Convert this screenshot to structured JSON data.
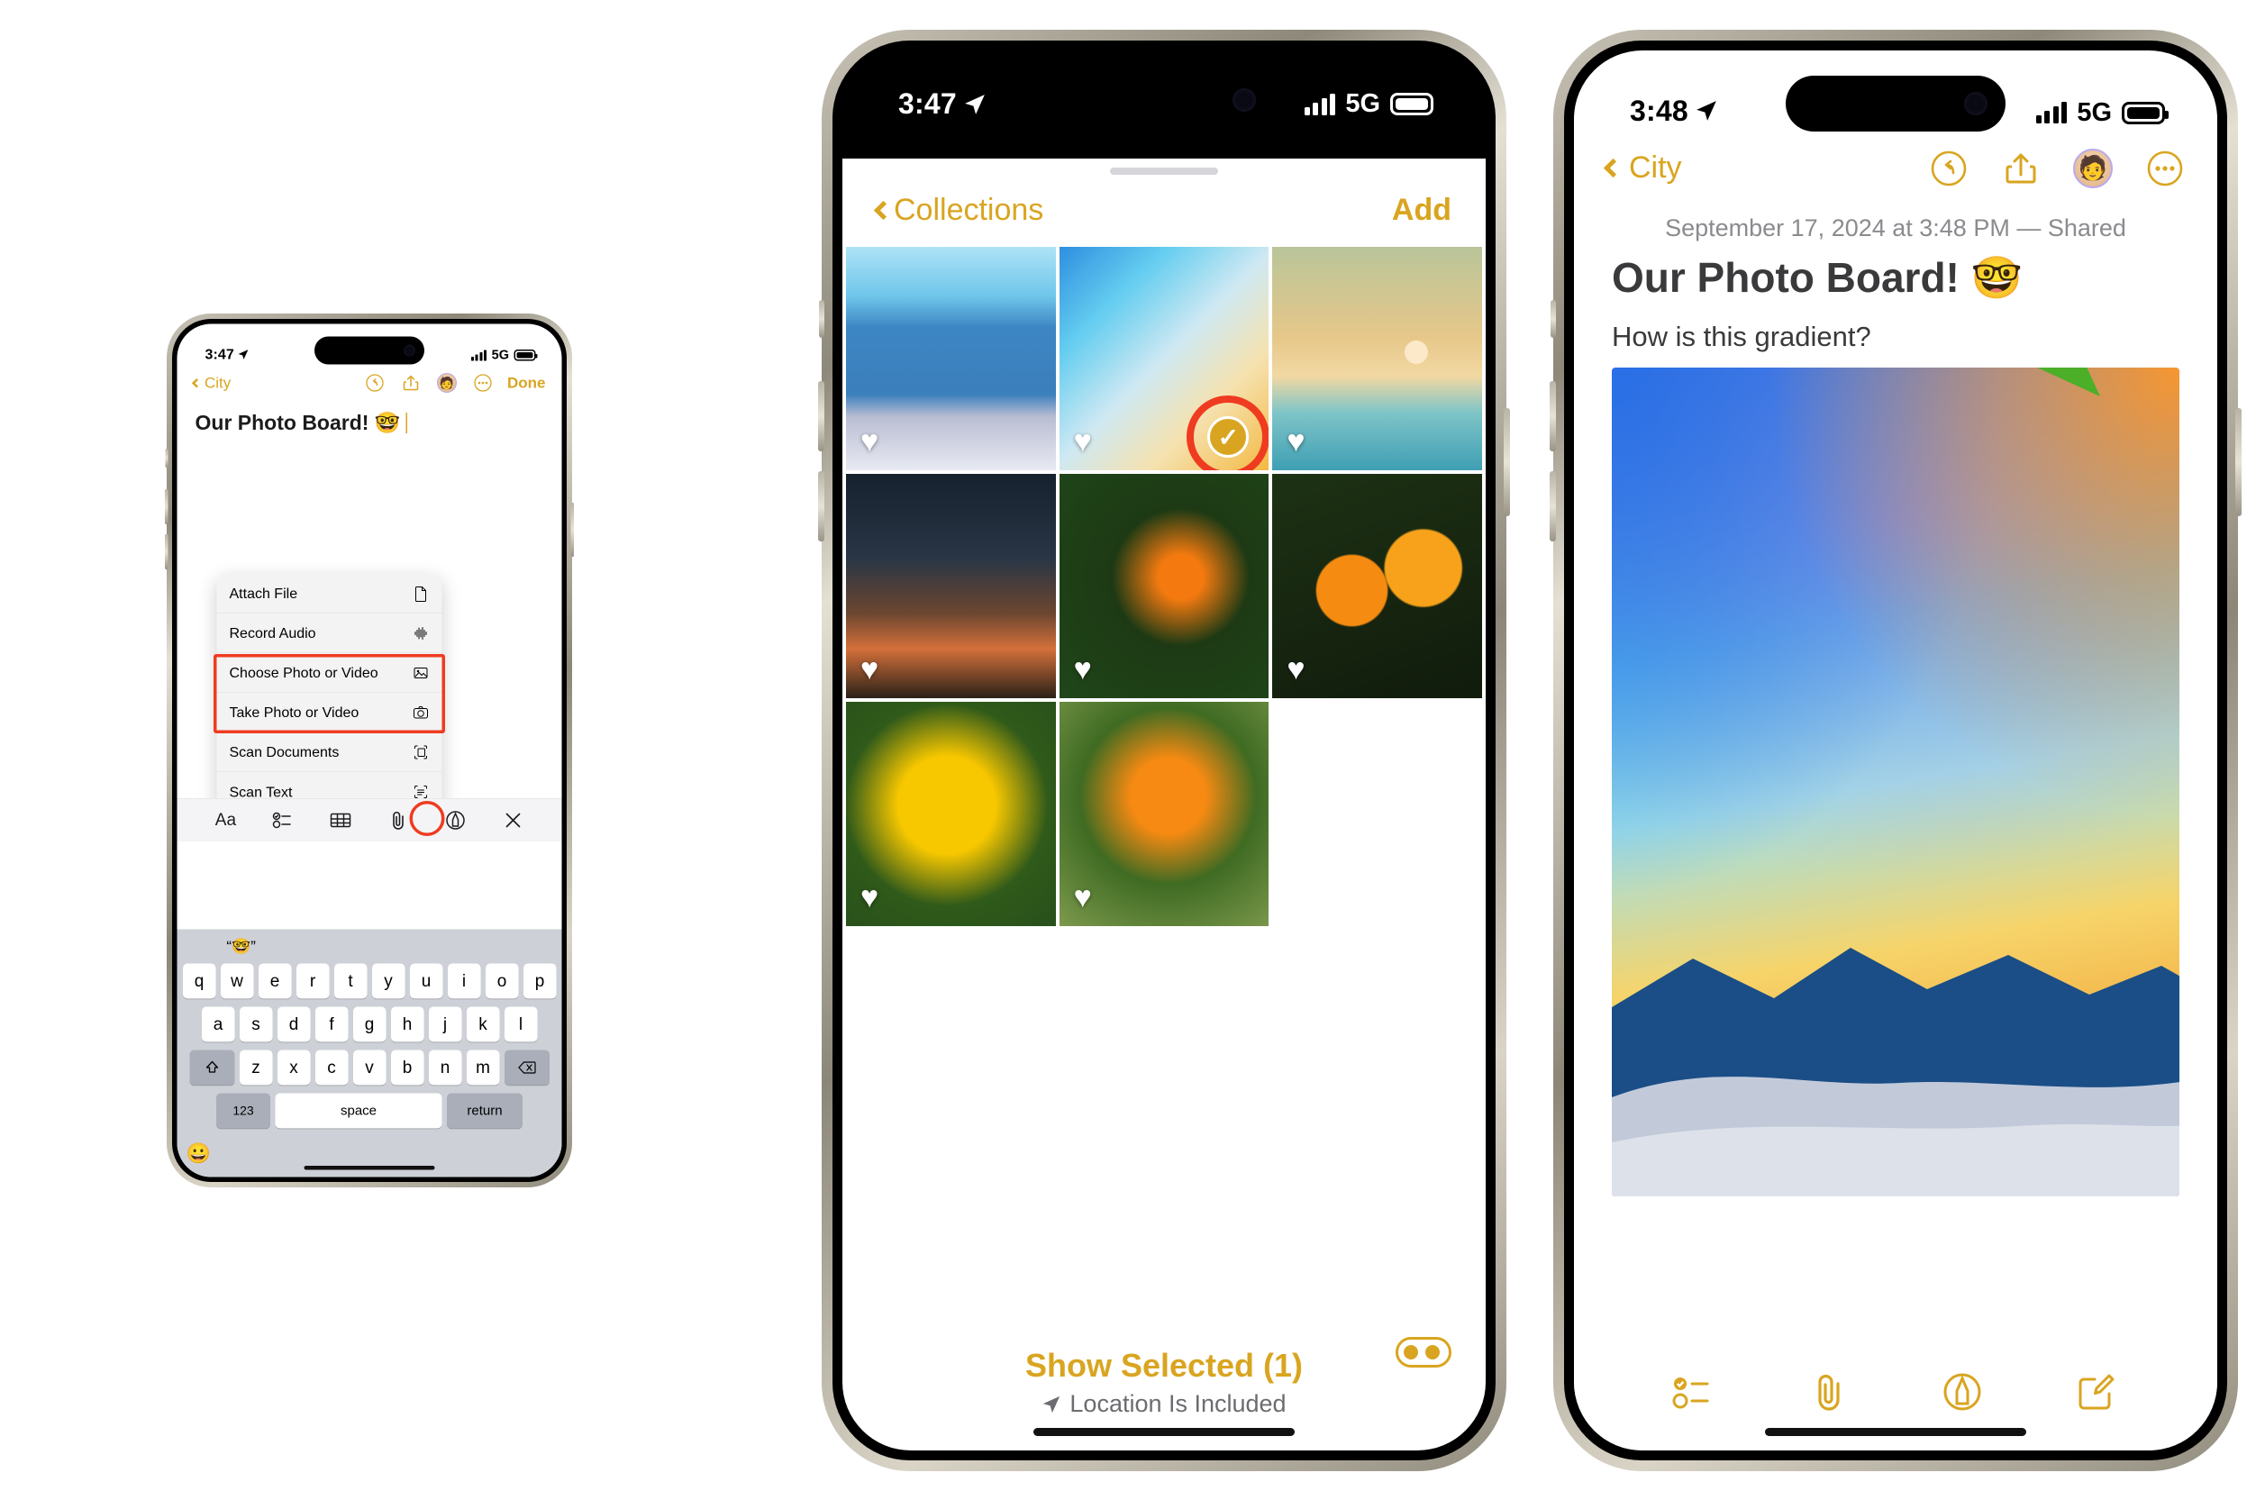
{
  "phone1": {
    "status": {
      "time": "3:47",
      "network": "5G",
      "location_icon": "location-arrow-icon"
    },
    "nav": {
      "back_label": "City",
      "done_label": "Done",
      "icons": [
        "undo-icon",
        "share-icon",
        "collaborator-avatar-icon",
        "more-icon"
      ]
    },
    "note": {
      "title": "Our Photo Board! 🤓"
    },
    "attach_menu": {
      "items": [
        {
          "label": "Attach File",
          "icon": "document-icon"
        },
        {
          "label": "Record Audio",
          "icon": "waveform-icon"
        },
        {
          "label": "Choose Photo or Video",
          "icon": "photo-library-icon"
        },
        {
          "label": "Take Photo or Video",
          "icon": "camera-icon"
        },
        {
          "label": "Scan Documents",
          "icon": "scan-document-icon"
        },
        {
          "label": "Scan Text",
          "icon": "scan-text-icon"
        }
      ],
      "highlighted_items": [
        "Choose Photo or Video",
        "Take Photo or Video"
      ]
    },
    "format_toolbar": {
      "items": [
        "Aa",
        "checklist-icon",
        "table-icon",
        "paperclip-icon",
        "markup-icon",
        "close-icon"
      ],
      "highlighted": "paperclip-icon"
    },
    "keyboard": {
      "prediction": "“🤓”",
      "row1": [
        "q",
        "w",
        "e",
        "r",
        "t",
        "y",
        "u",
        "i",
        "o",
        "p"
      ],
      "row2": [
        "a",
        "s",
        "d",
        "f",
        "g",
        "h",
        "j",
        "k",
        "l"
      ],
      "row3": [
        "z",
        "x",
        "c",
        "v",
        "b",
        "n",
        "m"
      ],
      "shift_icon": "shift-icon",
      "delete_icon": "delete-icon",
      "numbers_label": "123",
      "space_label": "space",
      "return_label": "return",
      "emoji_label": "😀"
    }
  },
  "phone2": {
    "status": {
      "time": "3:47",
      "network": "5G"
    },
    "nav": {
      "back_label": "Collections",
      "add_label": "Add",
      "add_highlighted": true
    },
    "grid": [
      {
        "name": "blue-mountain-gradient",
        "favorite": true,
        "selected": false
      },
      {
        "name": "cyan-orange-gradient",
        "favorite": true,
        "selected": true
      },
      {
        "name": "teal-sunrise-mountains",
        "favorite": true,
        "selected": false
      },
      {
        "name": "dusk-horizon",
        "favorite": true,
        "selected": false
      },
      {
        "name": "marigold-foliage",
        "favorite": true,
        "selected": false
      },
      {
        "name": "two-marigolds",
        "favorite": true,
        "selected": false
      },
      {
        "name": "large-yellow-marigold",
        "favorite": true,
        "selected": false
      },
      {
        "name": "single-orange-marigold",
        "favorite": true,
        "selected": false
      }
    ],
    "footer": {
      "show_selected": "Show Selected (1)",
      "location": "Location Is Included",
      "toggle_icon": "filters-toggle-icon"
    }
  },
  "phone3": {
    "status": {
      "time": "3:48",
      "network": "5G"
    },
    "nav": {
      "back_label": "City",
      "icons": [
        "undo-icon",
        "share-icon",
        "collaborator-avatar-icon",
        "more-icon"
      ]
    },
    "meta": "September 17, 2024 at 3:48 PM — Shared",
    "note": {
      "title": "Our Photo Board! 🤓",
      "body": "How is this gradient?"
    },
    "attachment": {
      "name": "gradient-mountain-photo",
      "annotation": "green-arrow-pointer"
    },
    "toolbar": [
      "checklist-icon",
      "paperclip-icon",
      "markup-icon",
      "compose-icon"
    ]
  },
  "colors": {
    "accent": "#d9a520",
    "highlight": "#ef3b20",
    "annotation": "#4caf28",
    "text": "#1c1c1e",
    "muted": "#8b8b8f"
  }
}
